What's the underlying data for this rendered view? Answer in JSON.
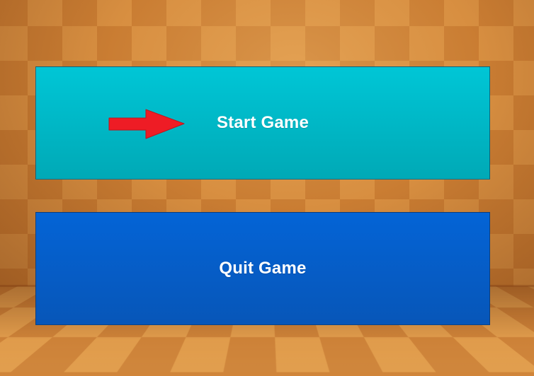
{
  "menu": {
    "start_label": "Start Game",
    "quit_label": "Quit Game"
  },
  "colors": {
    "start_button": "#00b8c6",
    "quit_button": "#065ec8",
    "arrow": "#ee1c25",
    "wall": "#cf8438"
  },
  "icons": {
    "selection_indicator": "right-arrow-icon"
  }
}
